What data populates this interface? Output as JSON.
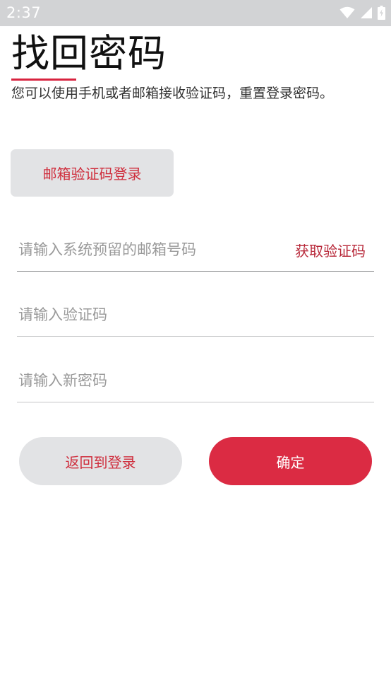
{
  "status_bar": {
    "time": "2:37",
    "icons": [
      "wifi-icon",
      "signal-icon",
      "battery-icon"
    ]
  },
  "page": {
    "title": "找回密码",
    "subtitle": "您可以使用手机或者邮箱接收验证码，重置登录密码。"
  },
  "buttons": {
    "email_code_login": "邮箱验证码登录",
    "get_code": "获取验证码",
    "back_to_login": "返回到登录",
    "confirm": "确定"
  },
  "fields": {
    "email_placeholder": "请输入系统预留的邮箱号码",
    "code_placeholder": "请输入验证码",
    "password_placeholder": "请输入新密码"
  },
  "colors": {
    "accent": "#db2b43",
    "accent_text": "#cf2d3c",
    "button_gray": "#e2e3e5",
    "status_bar": "#d2d3d5"
  }
}
